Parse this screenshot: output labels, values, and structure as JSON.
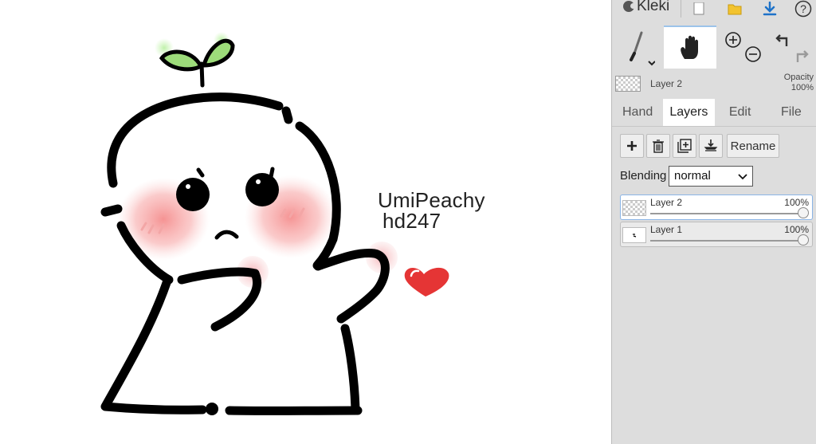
{
  "app": {
    "name": "Kleki"
  },
  "topbar": {
    "icons": [
      "new-document-icon",
      "open-folder-icon",
      "download-icon",
      "help-icon"
    ],
    "help_glyph": "?"
  },
  "tools": {
    "active": "hand",
    "items": [
      "brush-icon",
      "hand-icon",
      "zoom-in-icon",
      "zoom-out-icon",
      "undo-icon",
      "redo-icon"
    ]
  },
  "layer_preview": {
    "name": "Layer 2",
    "opacity_label": "Opacity",
    "opacity_value": "100%"
  },
  "tabs": [
    {
      "label": "Hand"
    },
    {
      "label": "Layers"
    },
    {
      "label": "Edit"
    },
    {
      "label": "File"
    }
  ],
  "active_tab": "Layers",
  "layers_panel": {
    "rename_label": "Rename",
    "blending_label": "Blending",
    "blending_value": "normal",
    "layers": [
      {
        "name": "Layer 2",
        "opacity": "100%",
        "opacity_fraction": 1.0,
        "selected": true
      },
      {
        "name": "Layer 1",
        "opacity": "100%",
        "opacity_fraction": 1.0,
        "selected": false
      }
    ]
  },
  "canvas": {
    "text_line_1": "UmiPeachy",
    "text_line_2": "hd247"
  },
  "colors": {
    "sidebar_bg": "#dddddd",
    "active_tab_bg": "#ffffff",
    "accent": "#1e72c8",
    "heart": "#e53535",
    "blush": "#f7a3a3",
    "sprout": "#9ddc7a"
  }
}
